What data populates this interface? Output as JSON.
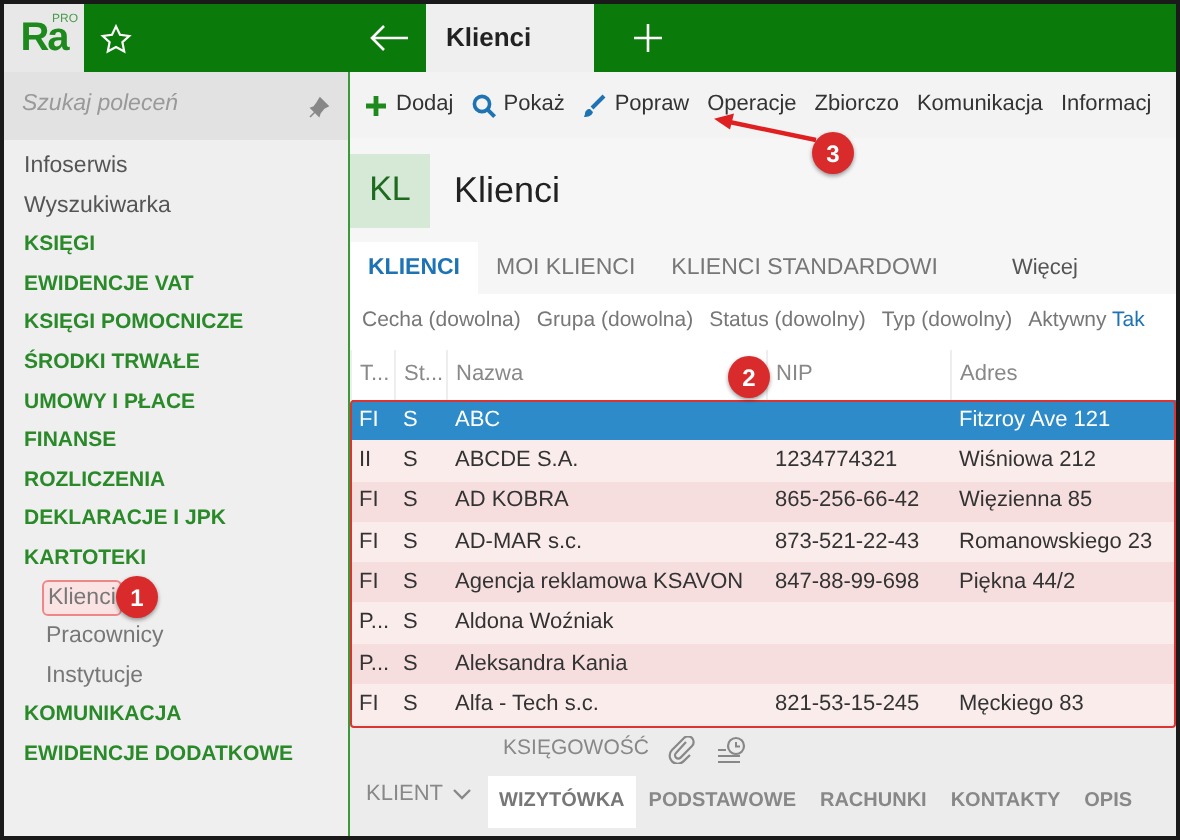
{
  "app": {
    "logo": "Ra",
    "logo_badge": "PRO"
  },
  "window": {
    "title": "Klienci"
  },
  "sidebar": {
    "search": {
      "placeholder": "Szukaj poleceń"
    },
    "items": [
      {
        "label": "Infoserwis",
        "kind": "link"
      },
      {
        "label": "Wyszukiwarka",
        "kind": "link"
      },
      {
        "label": "KSIĘGI",
        "kind": "section"
      },
      {
        "label": "EWIDENCJE VAT",
        "kind": "section"
      },
      {
        "label": "KSIĘGI POMOCNICZE",
        "kind": "section"
      },
      {
        "label": "ŚRODKI TRWAŁE",
        "kind": "section"
      },
      {
        "label": "UMOWY I PŁACE",
        "kind": "section"
      },
      {
        "label": "FINANSE",
        "kind": "section"
      },
      {
        "label": "ROZLICZENIA",
        "kind": "section"
      },
      {
        "label": "DEKLARACJE I JPK",
        "kind": "section"
      },
      {
        "label": "KARTOTEKI",
        "kind": "section",
        "children": [
          {
            "label": "Klienci",
            "highlighted": true
          },
          {
            "label": "Pracownicy",
            "highlighted": false
          },
          {
            "label": "Instytucje",
            "highlighted": false
          }
        ]
      },
      {
        "label": "KOMUNIKACJA",
        "kind": "section"
      },
      {
        "label": "EWIDENCJE DODATKOWE",
        "kind": "section"
      }
    ]
  },
  "toolbar": [
    {
      "label": "Dodaj",
      "kind": "plus"
    },
    {
      "label": "Pokaż",
      "kind": "search"
    },
    {
      "label": "Popraw",
      "kind": "brush"
    },
    {
      "label": "Operacje",
      "kind": "text"
    },
    {
      "label": "Zbiorczo",
      "kind": "text"
    },
    {
      "label": "Komunikacja",
      "kind": "text"
    },
    {
      "label": "Informacj",
      "kind": "text"
    }
  ],
  "page_header": {
    "badge": "KL",
    "title": "Klienci"
  },
  "tabs": [
    {
      "label": "KLIENCI",
      "selected": true
    },
    {
      "label": "MOI KLIENCI",
      "selected": false
    },
    {
      "label": "KLIENCI STANDARDOWI",
      "selected": false
    },
    {
      "label": "Więcej",
      "selected": false
    }
  ],
  "filters": [
    {
      "label": "Cecha (dowolna)"
    },
    {
      "label": "Grupa (dowolna)"
    },
    {
      "label": "Status (dowolny)"
    },
    {
      "label": "Typ (dowolny)"
    },
    {
      "label": "Aktywny",
      "value": "Tak"
    }
  ],
  "table": {
    "highlighted": true,
    "columns": [
      "T...",
      "St...",
      "Nazwa",
      "NIP",
      "Adres"
    ],
    "rows": [
      {
        "cells": [
          "FI",
          "S",
          "ABC",
          "",
          "Fitzroy Ave 121"
        ],
        "selected": true
      },
      {
        "cells": [
          "II",
          "S",
          "ABCDE S.A.",
          "1234774321",
          "Wiśniowa 212"
        ],
        "selected": false
      },
      {
        "cells": [
          "FI",
          "S",
          "AD KOBRA",
          "865-256-66-42",
          "Więzienna  85"
        ],
        "selected": false
      },
      {
        "cells": [
          "FI",
          "S",
          "AD-MAR s.c.",
          "873-521-22-43",
          "Romanowskiego 23"
        ],
        "selected": false
      },
      {
        "cells": [
          "FI",
          "S",
          "Agencja reklamowa KSAVON",
          "847-88-99-698",
          "Piękna  44/2"
        ],
        "selected": false
      },
      {
        "cells": [
          "P...",
          "S",
          "Aldona Woźniak",
          "",
          ""
        ],
        "selected": false
      },
      {
        "cells": [
          "P...",
          "S",
          "Aleksandra Kania",
          "",
          ""
        ],
        "selected": false
      },
      {
        "cells": [
          "FI",
          "S",
          "Alfa - Tech s.c.",
          "821-53-15-245",
          "Męckiego  83"
        ],
        "selected": false
      }
    ]
  },
  "bottom_panel": {
    "section": "KLIENT",
    "top_tabs": [
      "KSIĘGOWOŚĆ"
    ],
    "tabs": [
      {
        "label": "WIZYTÓWKA",
        "selected": true
      },
      {
        "label": "PODSTAWOWE",
        "selected": false
      },
      {
        "label": "RACHUNKI",
        "selected": false
      },
      {
        "label": "KONTAKTY",
        "selected": false
      },
      {
        "label": "OPIS",
        "selected": false
      }
    ]
  },
  "callouts": [
    {
      "number": "1"
    },
    {
      "number": "2"
    },
    {
      "number": "3"
    }
  ]
}
